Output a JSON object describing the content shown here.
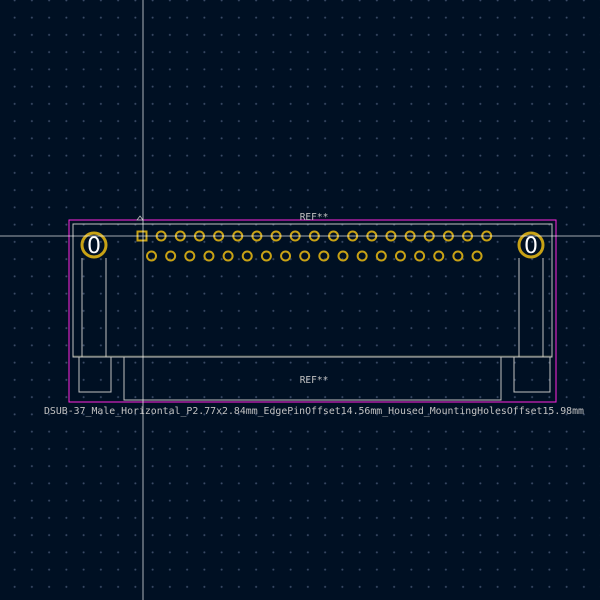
{
  "footprint": {
    "reference_top": "REF**",
    "reference_fab": "REF**",
    "value": "DSUB-37_Male_Horizontal_P2.77x2.84mm_EdgePinOffset14.56mm_Housed_MountingHolesOffset15.98mm",
    "mounting_hole_label": "0",
    "pin_count": 37,
    "row1_pins": 19,
    "row2_pins": 18
  },
  "colors": {
    "background": "#001023",
    "courtyard": "#ff26e2",
    "silkscreen": "#f2eda1",
    "fab": "#c2c2c2",
    "pad": "#c8a215",
    "crosshair": "#ffffff"
  },
  "icons": {
    "mounting_hole": "circle-pad-icon",
    "pad": "round-pad-icon",
    "pin1": "square-pad-icon",
    "cursor": "crosshair-icon"
  }
}
